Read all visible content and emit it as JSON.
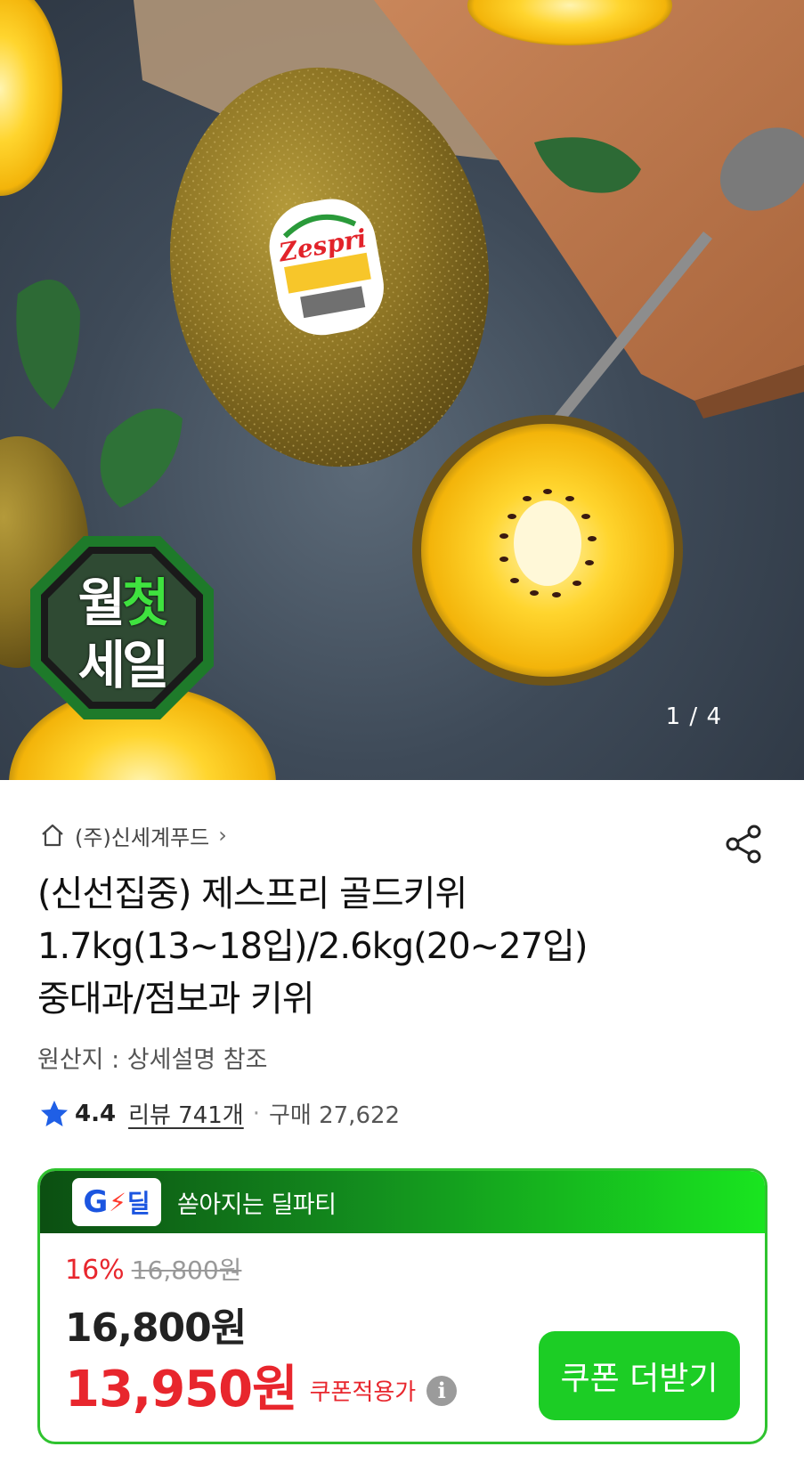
{
  "image": {
    "page_counter": "1 / 4",
    "badge_line1_a": "월",
    "badge_line1_b": "첫",
    "badge_line2": "세일",
    "sticker_brand": "Zespri"
  },
  "breadcrumb": {
    "seller": "(주)신세계푸드"
  },
  "product": {
    "title_line1": "(신선집중) 제스프리 골드키위",
    "title_line2": "1.7kg(13~18입)/2.6kg(20~27입)",
    "title_line3": "중대과/점보과 키위",
    "origin": "원산지 : 상세설명 참조"
  },
  "rating": {
    "score": "4.4",
    "review_label": "리뷰 741개",
    "separator": "·",
    "purchase_label": "구매 27,622"
  },
  "deal": {
    "logo_text": "G",
    "logo_text2": "딜",
    "head_text": "쏟아지는 딜파티",
    "discount_rate": "16%",
    "original_price": "16,800원",
    "sale_price": "16,800원",
    "coupon_price": "13,950원",
    "coupon_label": "쿠폰적용가",
    "coupon_button": "쿠폰 더받기"
  },
  "colors": {
    "accent_red": "#e8262d",
    "deal_green": "#1ccd25",
    "rating_star": "#1f5fe6"
  }
}
